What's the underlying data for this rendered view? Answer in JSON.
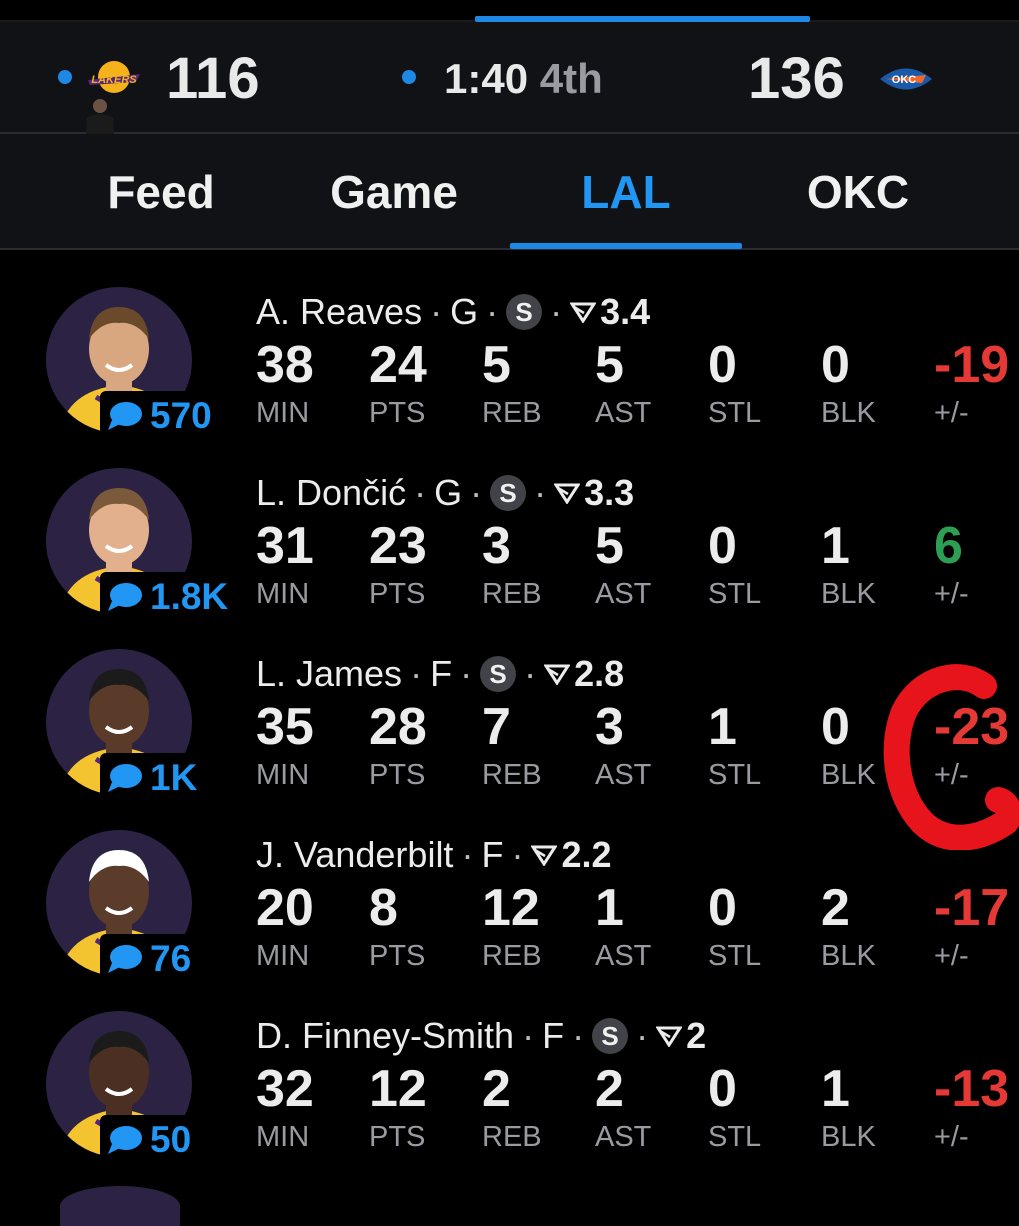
{
  "scoreboard": {
    "home": {
      "team": "LAL",
      "score": "116",
      "logo_icon": "lakers-logo-icon"
    },
    "away": {
      "team": "OKC",
      "score": "136",
      "logo_icon": "thunder-logo-icon"
    },
    "clock": "1:40",
    "period": "4th",
    "accent_color": "#1e88e5"
  },
  "tabs": [
    {
      "label": "Feed"
    },
    {
      "label": "Game"
    },
    {
      "label": "LAL",
      "active": true
    },
    {
      "label": "OKC"
    }
  ],
  "stat_labels": [
    "MIN",
    "PTS",
    "REB",
    "AST",
    "STL",
    "BLK",
    "+/-"
  ],
  "players": [
    {
      "name": "A. Reaves",
      "pos": "G",
      "starter": "S",
      "rating": "3.4",
      "comments": "570",
      "min": "38",
      "pts": "24",
      "reb": "5",
      "ast": "5",
      "stl": "0",
      "blk": "0",
      "pm": "-19",
      "pm_color": "#e53935"
    },
    {
      "name": "L. Dončić",
      "pos": "G",
      "starter": "S",
      "rating": "3.3",
      "comments": "1.8K",
      "min": "31",
      "pts": "23",
      "reb": "3",
      "ast": "5",
      "stl": "0",
      "blk": "1",
      "pm": "6",
      "pm_color": "#2e9e55"
    },
    {
      "name": "L. James",
      "pos": "F",
      "starter": "S",
      "rating": "2.8",
      "comments": "1K",
      "min": "35",
      "pts": "28",
      "reb": "7",
      "ast": "3",
      "stl": "1",
      "blk": "0",
      "pm": "-23",
      "pm_color": "#e53935"
    },
    {
      "name": "J. Vanderbilt",
      "pos": "F",
      "starter": "",
      "rating": "2.2",
      "comments": "76",
      "min": "20",
      "pts": "8",
      "reb": "12",
      "ast": "1",
      "stl": "0",
      "blk": "2",
      "pm": "-17",
      "pm_color": "#e53935"
    },
    {
      "name": "D. Finney-Smith",
      "pos": "F",
      "starter": "S",
      "rating": "2",
      "comments": "50",
      "min": "32",
      "pts": "12",
      "reb": "2",
      "ast": "2",
      "stl": "0",
      "blk": "1",
      "pm": "-13",
      "pm_color": "#e53935"
    }
  ],
  "separator": "·",
  "annotation_color": "#e8141c"
}
